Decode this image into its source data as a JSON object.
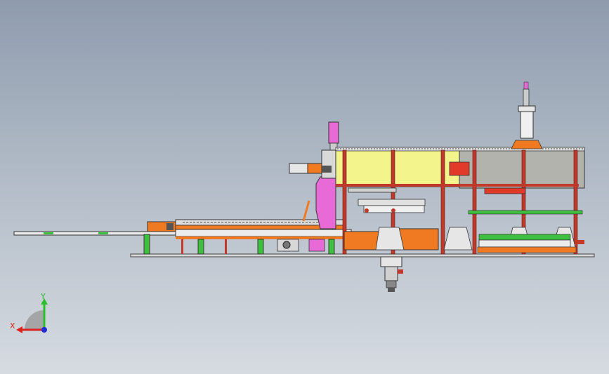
{
  "triad": {
    "x_label": "X",
    "y_label": "Y",
    "x_color": "#d9231e",
    "y_color": "#2bbf2b",
    "z_color": "#1e2bd9"
  },
  "colors": {
    "frame": "#c0392b",
    "yellow_panel": "#f3f48b",
    "grey_panel": "#b3b3ad",
    "magenta": "#e86ad6",
    "orange": "#f07a22",
    "green": "#3fbf3f",
    "steel": "#c8c8c8",
    "dark": "#3a3a3a"
  }
}
